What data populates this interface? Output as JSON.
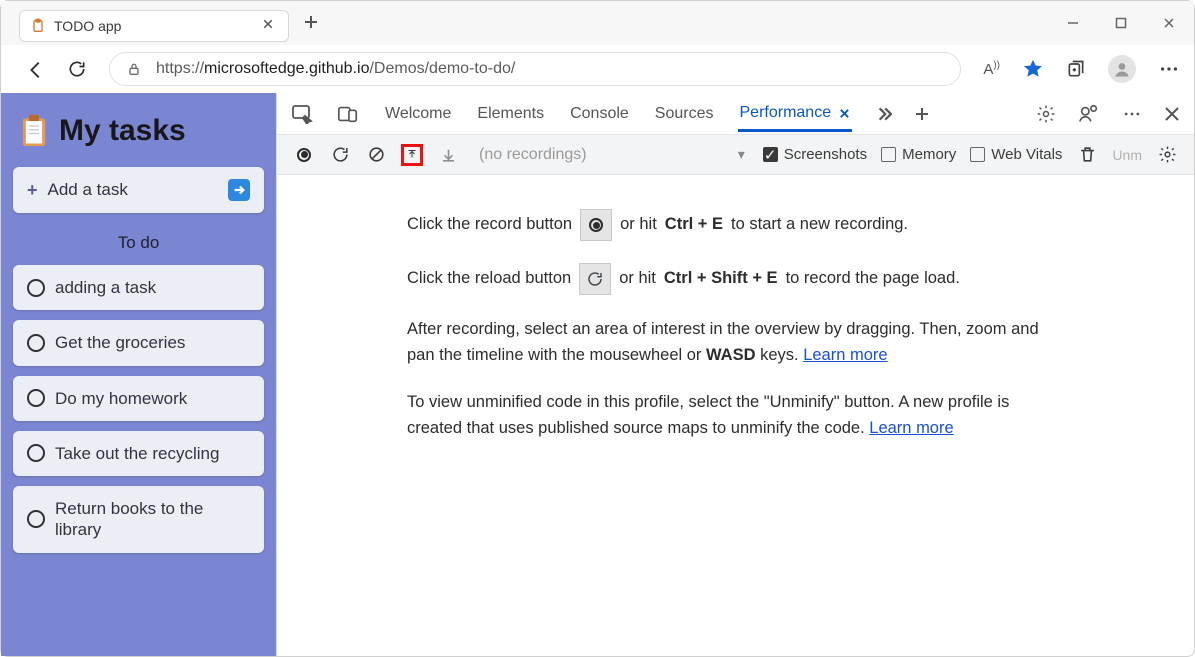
{
  "browser": {
    "tab_title": "TODO app",
    "url_prefix": "https://",
    "url_host": "microsoftedge.github.io",
    "url_path": "/Demos/demo-to-do/"
  },
  "app": {
    "title": "My tasks",
    "add_label": "Add a task",
    "section": "To do",
    "tasks": [
      {
        "text": "adding a task"
      },
      {
        "text": "Get the groceries"
      },
      {
        "text": "Do my homework"
      },
      {
        "text": "Take out the recycling"
      },
      {
        "text": "Return books to the library"
      }
    ]
  },
  "devtools": {
    "tabs": {
      "welcome": "Welcome",
      "elements": "Elements",
      "console": "Console",
      "sources": "Sources",
      "performance": "Performance"
    },
    "perfbar": {
      "no_recordings": "(no recordings)",
      "screenshots": "Screenshots",
      "memory": "Memory",
      "web_vitals": "Web Vitals",
      "unm": "Unm"
    },
    "body": {
      "l1_a": "Click the record button",
      "l1_b": "or hit",
      "l1_k": "Ctrl + E",
      "l1_c": "to start a new recording.",
      "l2_a": "Click the reload button",
      "l2_b": "or hit",
      "l2_k": "Ctrl + Shift + E",
      "l2_c": "to record the page load.",
      "p1_a": "After recording, select an area of interest in the overview by dragging. Then, zoom and pan the timeline with the mousewheel or ",
      "p1_k": "WASD",
      "p1_b": " keys. ",
      "learn_more": "Learn more",
      "p2": "To view unminified code in this profile, select the \"Unminify\" button. A new profile is created that uses published source maps to unminify the code. "
    }
  }
}
